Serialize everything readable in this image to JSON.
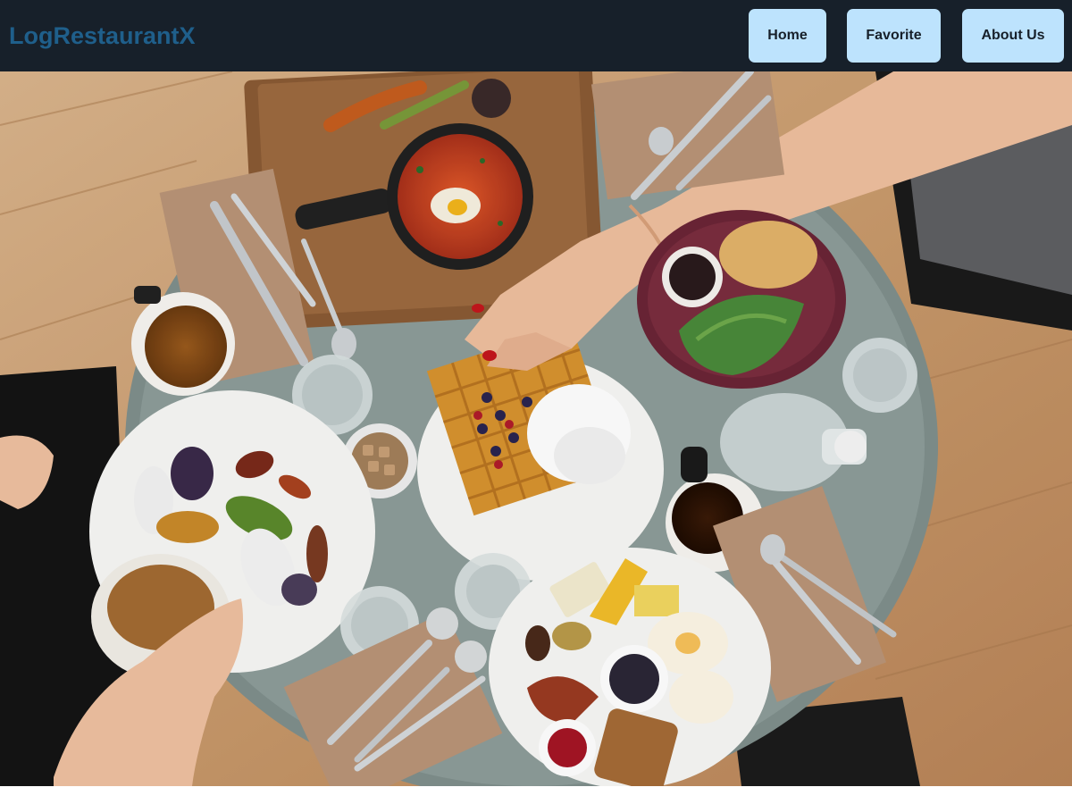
{
  "brand": {
    "title": "LogRestaurantX"
  },
  "nav": {
    "home_label": "Home",
    "favorite_label": "Favorite",
    "about_label": "About Us"
  },
  "hero": {
    "image_subject": "overhead-breakfast-table-photo"
  },
  "colors": {
    "navbar_bg": "#17202a",
    "brand_text": "#1f5f8b",
    "nav_button_bg": "#bde3fd",
    "nav_button_text": "#17202a"
  }
}
